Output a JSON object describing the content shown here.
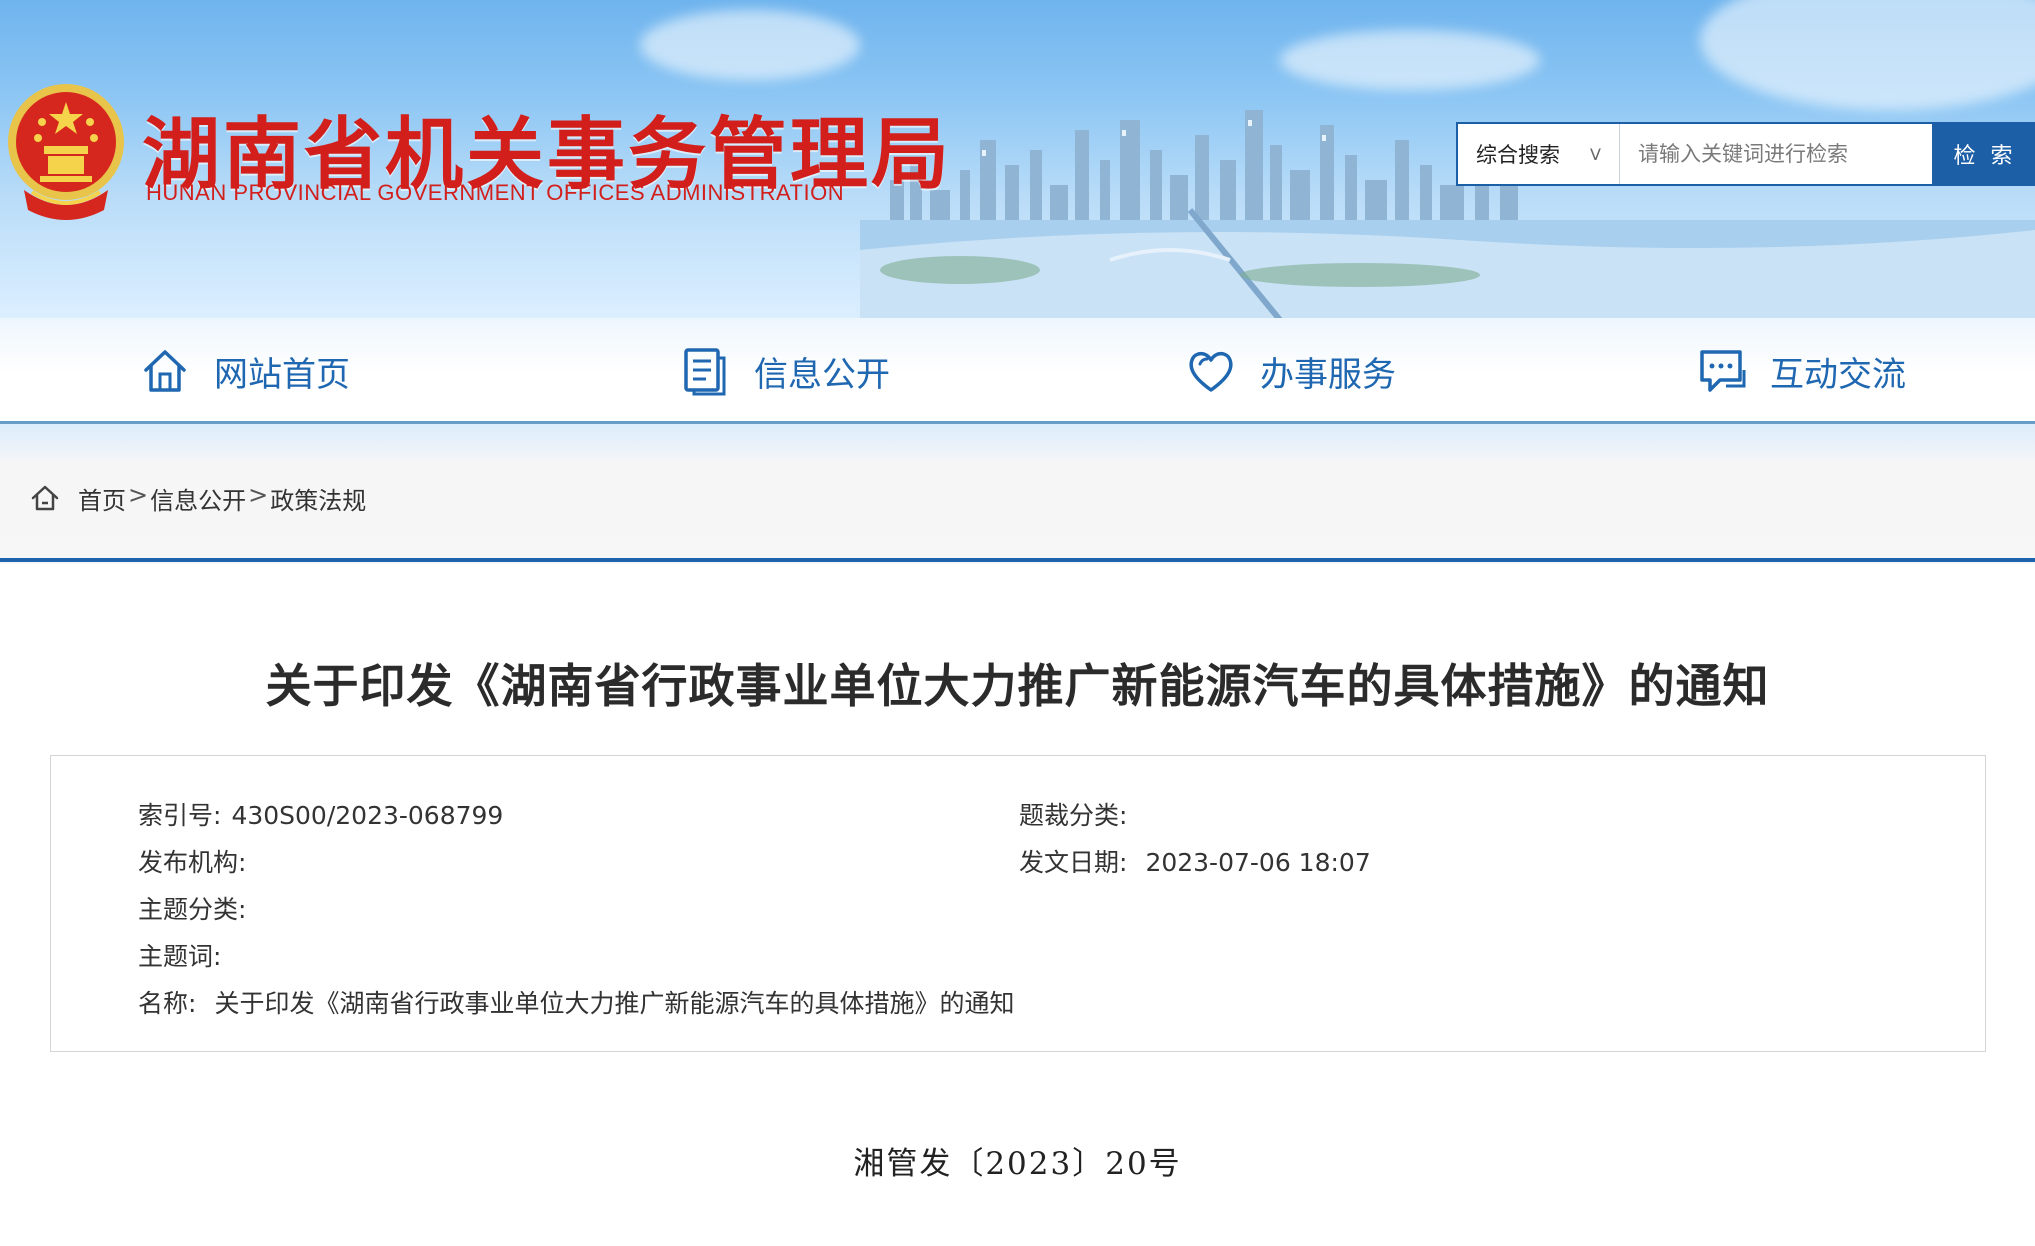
{
  "header": {
    "title_cn": "湖南省机关事务管理局",
    "title_en": "HUNAN PROVINCIAL GOVERNMENT OFFICES ADMINISTRATION",
    "emblem_icon": "national-emblem-icon"
  },
  "search": {
    "category": "综合搜索",
    "placeholder": "请输入关键词进行检索",
    "value": "",
    "button_label": "检 索"
  },
  "nav": {
    "items": [
      {
        "label": "网站首页",
        "icon": "home-icon"
      },
      {
        "label": "信息公开",
        "icon": "document-icon"
      },
      {
        "label": "办事服务",
        "icon": "heart-icon"
      },
      {
        "label": "互动交流",
        "icon": "chat-icon"
      }
    ]
  },
  "breadcrumb": {
    "icon": "home-icon",
    "items": [
      "首页",
      "信息公开",
      "政策法规"
    ],
    "separator": ">"
  },
  "article": {
    "title": "关于印发《湖南省行政事业单位大力推广新能源汽车的具体措施》的通知",
    "meta": {
      "index_label": "索引号:",
      "index_value": "430S00/2023-068799",
      "genre_label": "题裁分类:",
      "genre_value": "",
      "issuer_label": "发布机构:",
      "issuer_value": "",
      "date_label": "发文日期:",
      "date_value": "2023-07-06 18:07",
      "subject_label": "主题分类:",
      "subject_value": "",
      "keywords_label": "主题词:",
      "keywords_value": "",
      "name_label": "名称:",
      "name_value": "关于印发《湖南省行政事业单位大力推广新能源汽车的具体措施》的通知"
    },
    "doc_number": "湘管发〔2023〕20号"
  },
  "colors": {
    "brand_red": "#d21f1b",
    "nav_blue": "#1f67b1",
    "accent_blue": "#1d64ac"
  }
}
